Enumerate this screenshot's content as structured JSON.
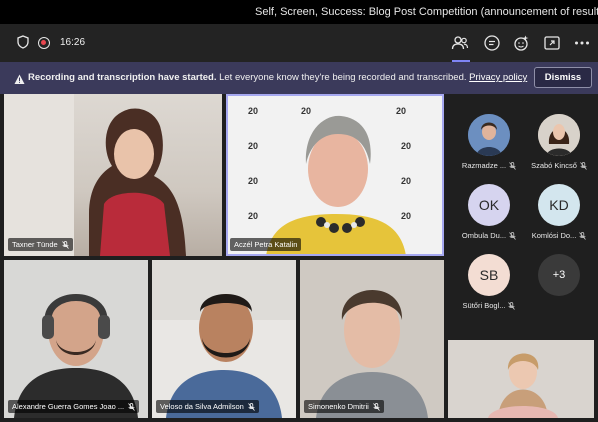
{
  "window": {
    "title": "Self, Screen, Success: Blog Post Competition (announcement of results)"
  },
  "toolbar": {
    "timer": "16:26",
    "icons": [
      "people-icon",
      "chat-icon",
      "reactions-icon",
      "share-tray-icon",
      "more-icon"
    ]
  },
  "banner": {
    "bold": "Recording and transcription have started.",
    "text": " Let everyone know they're being recorded and transcribed.",
    "link": "Privacy policy",
    "dismiss": "Dismiss"
  },
  "video_tiles": [
    {
      "name": "Taxner Tünde",
      "muted": true
    },
    {
      "name": "Aczél Petra Katalin",
      "muted": false,
      "speaking": true
    },
    {
      "name": "Alexandre Guerra Gomes Joao ...",
      "muted": true
    },
    {
      "name": "Veloso da Silva Admilson",
      "muted": true
    },
    {
      "name": "Simonenko Dmitrii",
      "muted": true
    }
  ],
  "roster": [
    {
      "name": "Razmadze ...",
      "initials": "",
      "muted": true,
      "color": "#4a6fa5"
    },
    {
      "name": "Szabó Kincső",
      "initials": "",
      "muted": true,
      "color": "#c9b9a8"
    },
    {
      "name": "Ombula Du...",
      "initials": "OK",
      "muted": true,
      "color": "#d6d4ef"
    },
    {
      "name": "Komlósi Do...",
      "initials": "KD",
      "muted": true,
      "color": "#d3e6ee"
    },
    {
      "name": "Sütőri Bogl...",
      "initials": "SB",
      "muted": true,
      "color": "#f3ddd3"
    },
    {
      "name": "",
      "initials": "+3",
      "muted": false,
      "color": "#3a3a3a"
    }
  ],
  "colors": {
    "accent": "#7f85f5",
    "banner": "#3b3a5b",
    "record": "#e8464f"
  }
}
